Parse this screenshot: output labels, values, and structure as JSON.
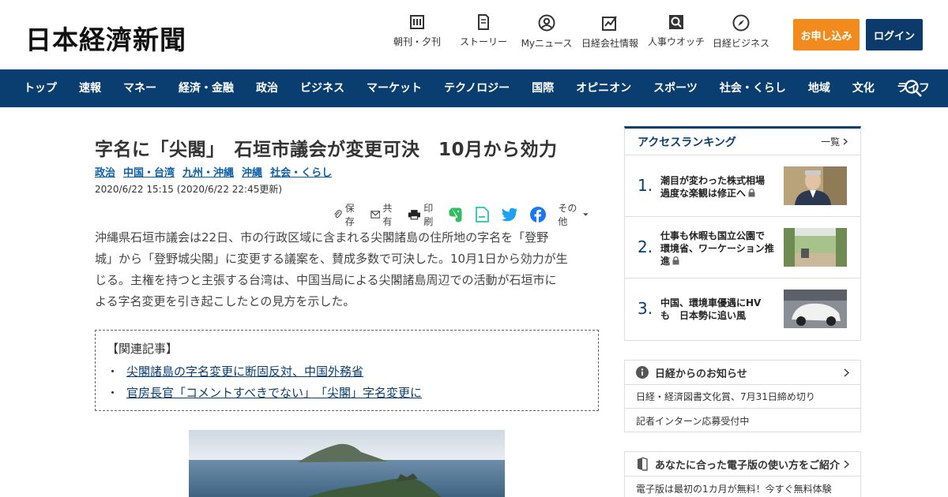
{
  "header": {
    "logo": "日本経濟新聞",
    "icons": [
      {
        "label": "朝刊・夕刊",
        "icon": "newspaper-icon"
      },
      {
        "label": "ストーリー",
        "icon": "story-icon"
      },
      {
        "label": "Myニュース",
        "icon": "user-icon"
      },
      {
        "label": "日経会社情報",
        "icon": "chart-icon"
      },
      {
        "label": "人事ウオッチ",
        "icon": "search-person-icon"
      },
      {
        "label": "日経ビジネス",
        "icon": "compass-icon"
      }
    ],
    "apply_label": "お申し込み",
    "login_label": "ログイン",
    "colors": {
      "apply": "#f28b1d",
      "login": "#0c3b6b",
      "nav": "#0b3e70"
    }
  },
  "nav": {
    "items": [
      "トップ",
      "速報",
      "マネー",
      "経済・金融",
      "政治",
      "ビジネス",
      "マーケット",
      "テクノロジー",
      "国際",
      "オピニオン",
      "スポーツ",
      "社会・くらし",
      "地域",
      "文化",
      "ライフ"
    ]
  },
  "article": {
    "title": "字名に「尖閣」　石垣市議会が変更可決　10月から効力",
    "topics": [
      "政治",
      "中国・台湾",
      "九州・沖縄",
      "沖縄",
      "社会・くらし"
    ],
    "date": "2020/6/22 15:15 (2020/6/22 22:45更新)",
    "share": {
      "save": "保存",
      "share": "共有",
      "print": "印刷",
      "more": "その他"
    },
    "body_lines": [
      "沖縄県石垣市議会は22日、市の行政区域に含まれる尖閣諸島の住所地の字名を「登野",
      "城」から「登野城尖閣」に変更する議案を、賛成多数で可決した。10月1日から効力が生",
      "じる。主権を持つと主張する台湾は、中国当局による尖閣諸島周辺での活動が石垣市に",
      "よる字名変更を引き起こしたとの見方を示した。"
    ],
    "related": {
      "heading": "【関連記事】",
      "items": [
        "尖閣諸島の字名変更に断固反対、中国外務省",
        "官房長官「コメントすべきでない」　「尖閣」字名変更に"
      ]
    }
  },
  "sidebar": {
    "ranking": {
      "title": "アクセスランキング",
      "more": "一覧",
      "items": [
        {
          "rank": "1.",
          "lines": [
            "潮目が変わった株式相場",
            "過度な楽観は修正へ"
          ]
        },
        {
          "rank": "2.",
          "lines": [
            "仕事も休暇も国立公園で",
            "環境省、ワーケーション推",
            "進"
          ]
        },
        {
          "rank": "3.",
          "lines": [
            "中国、環境車優遇にHV",
            "も　日本勢に追い風"
          ]
        }
      ]
    },
    "notice": {
      "title": "日経からのお知らせ",
      "items": [
        "日経・経済図書文化賞、7月31日締め切り",
        "記者インターン応募受付中"
      ]
    },
    "guide": {
      "title": "あなたに合った電子版の使い方をご紹介",
      "items": [
        "電子版は最初の1カ月が無料！今すぐ無料体験"
      ]
    }
  }
}
